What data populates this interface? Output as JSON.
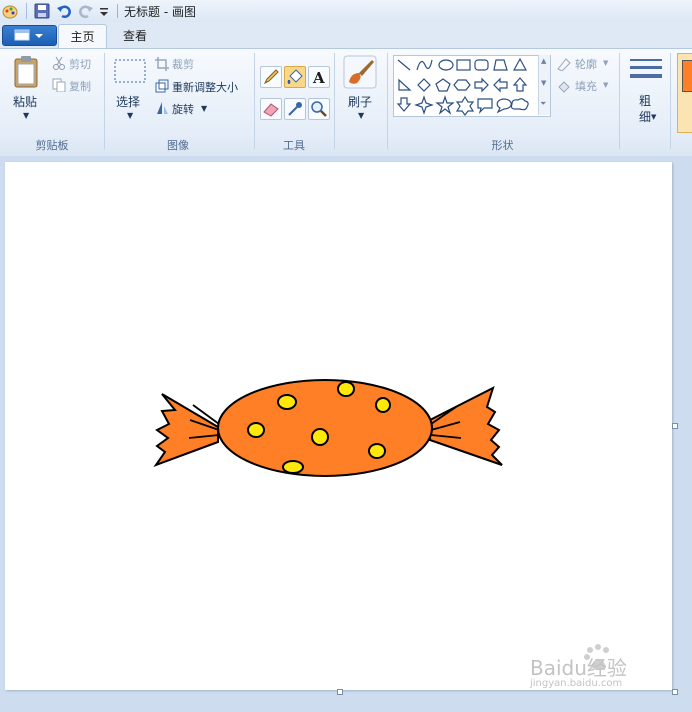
{
  "window": {
    "title": "无标题 - 画图"
  },
  "tabs": [
    {
      "label": "主页",
      "active": true
    },
    {
      "label": "查看",
      "active": false
    }
  ],
  "clipboard": {
    "group_label": "剪贴板",
    "paste_label": "粘贴",
    "cut_label": "剪切",
    "copy_label": "复制"
  },
  "image": {
    "group_label": "图像",
    "select_label": "选择",
    "crop_label": "裁剪",
    "resize_label": "重新调整大小",
    "rotate_label": "旋转"
  },
  "tools": {
    "group_label": "工具"
  },
  "brushes": {
    "label": "刷子"
  },
  "shapes": {
    "group_label": "形状",
    "outline_label": "轮廓",
    "fill_label": "填充"
  },
  "size": {
    "label": "粗细"
  },
  "colors": {
    "candy_fill": "#ff7f27",
    "dot_fill": "#ffe80a",
    "outline": "#000000",
    "active_color": "#ff7f27"
  },
  "watermark": {
    "text": "Baidu经验",
    "subtext": "jingyan.baidu.com"
  }
}
